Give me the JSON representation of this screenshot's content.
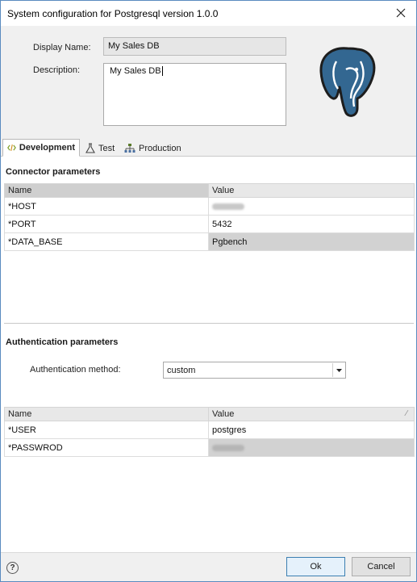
{
  "window": {
    "title": "System configuration for Postgresql version 1.0.0"
  },
  "header": {
    "display_name_label": "Display Name:",
    "display_name_value": "My Sales DB",
    "description_label": "Description:",
    "description_value": "My Sales DB",
    "logo_icon": "postgresql-elephant-icon"
  },
  "tabs": [
    {
      "label": "Development",
      "icon": "code-icon",
      "active": true
    },
    {
      "label": "Test",
      "icon": "flask-icon",
      "active": false
    },
    {
      "label": "Production",
      "icon": "network-icon",
      "active": false
    }
  ],
  "connector": {
    "title": "Connector parameters",
    "columns": [
      "Name",
      "Value"
    ],
    "rows": [
      {
        "name": "*HOST",
        "value": "",
        "blurred": true
      },
      {
        "name": "*PORT",
        "value": "5432",
        "blurred": false
      },
      {
        "name": "*DATA_BASE",
        "value": "Pgbench",
        "blurred": false,
        "selected": true
      }
    ]
  },
  "auth": {
    "title": "Authentication parameters",
    "method_label": "Authentication method:",
    "method_value": "custom",
    "columns": [
      "Name",
      "Value"
    ],
    "rows": [
      {
        "name": "*USER",
        "value": "postgres",
        "blurred": false
      },
      {
        "name": "*PASSWROD",
        "value": "",
        "blurred": true,
        "selected": true
      }
    ]
  },
  "footer": {
    "help": "?",
    "ok": "Ok",
    "cancel": "Cancel"
  },
  "colors": {
    "accent": "#336791",
    "window_border": "#5a8bbf",
    "selection": "#d2d2d2"
  }
}
